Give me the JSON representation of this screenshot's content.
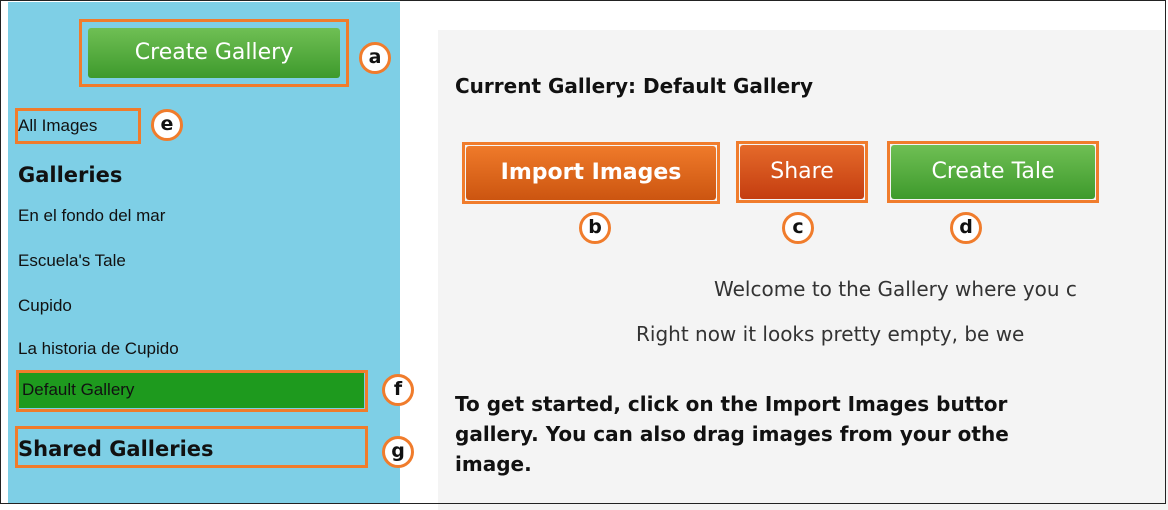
{
  "sidebar": {
    "create_gallery_label": "Create Gallery",
    "all_images_label": "All Images",
    "galleries_heading": "Galleries",
    "gallery_items": [
      "En el fondo del mar",
      "Escuela's Tale",
      "Cupido",
      "La historia de Cupido"
    ],
    "selected_gallery": "Default Gallery",
    "shared_galleries_heading": "Shared Galleries"
  },
  "main": {
    "current_gallery_label": "Current Gallery: Default Gallery",
    "import_images_label": "Import Images",
    "share_label": "Share",
    "create_tale_label": "Create Tale",
    "welcome_line_1": "Welcome to the Gallery where you c",
    "welcome_line_2": "Right now it looks pretty empty, be we",
    "instructions_line_1": "To get started, click on the Import Images buttor",
    "instructions_line_2": "gallery. You can also drag images from your othe",
    "instructions_line_3": "image."
  },
  "callouts": {
    "a": "a",
    "b": "b",
    "c": "c",
    "d": "d",
    "e": "e",
    "f": "f",
    "g": "g"
  },
  "colors": {
    "sidebar_bg": "#7ecfe6",
    "highlight": "#f07c2c",
    "selected_gallery_bg": "#1e9a1e",
    "green_button": "#4ea83a",
    "orange_button": "#e0661e"
  }
}
